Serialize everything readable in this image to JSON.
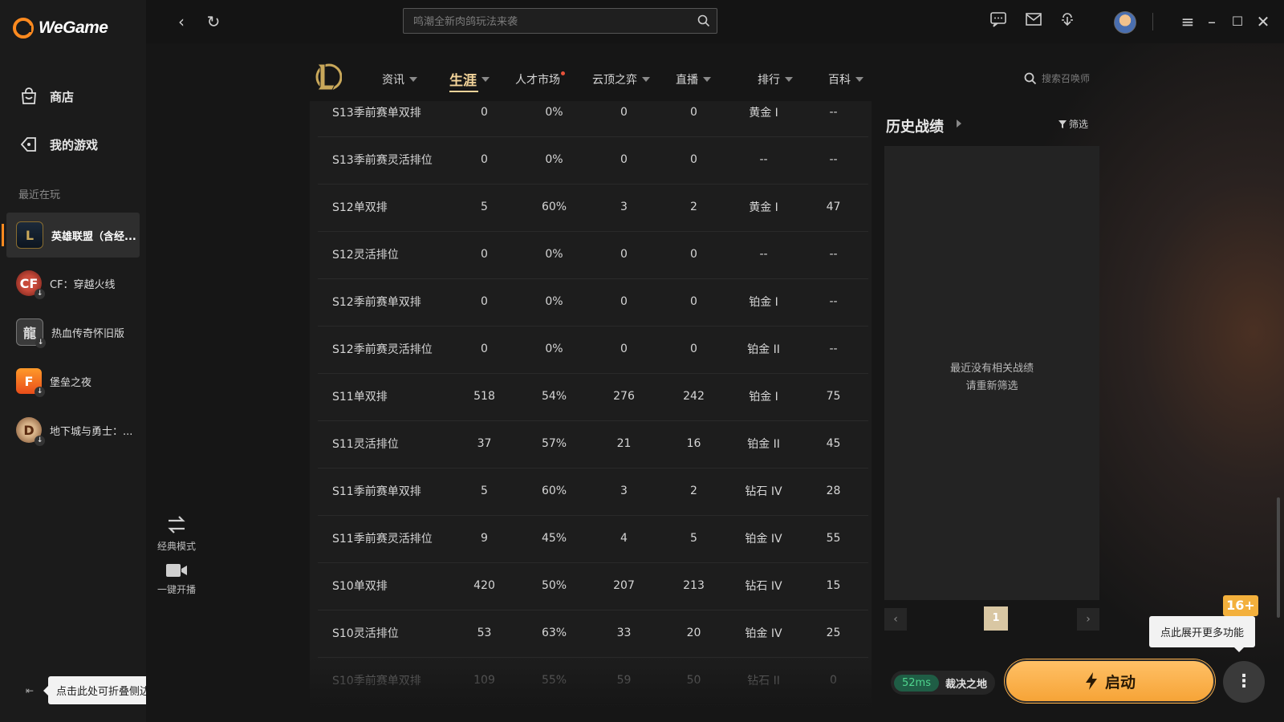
{
  "app": {
    "logo_text": "WeGame"
  },
  "sidebar": {
    "store_label": "商店",
    "mygames_label": "我的游戏",
    "recent_label": "最近在玩",
    "games": [
      {
        "name": "英雄联盟（含经...",
        "icon": "lol-icon",
        "active": true
      },
      {
        "name": "CF：穿越火线",
        "icon": "cf-icon",
        "active": false
      },
      {
        "name": "热血传奇怀旧版",
        "icon": "legend-icon",
        "active": false
      },
      {
        "name": "堡垒之夜",
        "icon": "fortnite-icon",
        "active": false
      },
      {
        "name": "地下城与勇士：...",
        "icon": "dnf-icon",
        "active": false
      }
    ],
    "collapse_tip": "点击此处可折叠侧边栏"
  },
  "topbar": {
    "search_placeholder": "鸣潮全新肉鸽玩法来袭"
  },
  "nav": {
    "items": [
      {
        "label": "资讯",
        "caret": true
      },
      {
        "label": "生涯",
        "caret": true,
        "active": true
      },
      {
        "label": "人才市场",
        "caret": false,
        "dot": true
      },
      {
        "label": "云顶之弈",
        "caret": true
      },
      {
        "label": "直播",
        "caret": true
      },
      {
        "label": "排行",
        "caret": true
      },
      {
        "label": "百科",
        "caret": true
      }
    ],
    "summoner_search_placeholder": "搜索召唤师"
  },
  "table": {
    "rows": [
      [
        "S13季前赛单双排",
        "0",
        "0%",
        "0",
        "0",
        "黄金 I",
        "--"
      ],
      [
        "S13季前赛灵活排位",
        "0",
        "0%",
        "0",
        "0",
        "--",
        "--"
      ],
      [
        "S12单双排",
        "5",
        "60%",
        "3",
        "2",
        "黄金 I",
        "47"
      ],
      [
        "S12灵活排位",
        "0",
        "0%",
        "0",
        "0",
        "--",
        "--"
      ],
      [
        "S12季前赛单双排",
        "0",
        "0%",
        "0",
        "0",
        "铂金 I",
        "--"
      ],
      [
        "S12季前赛灵活排位",
        "0",
        "0%",
        "0",
        "0",
        "铂金 II",
        "--"
      ],
      [
        "S11单双排",
        "518",
        "54%",
        "276",
        "242",
        "铂金 I",
        "75"
      ],
      [
        "S11灵活排位",
        "37",
        "57%",
        "21",
        "16",
        "铂金 II",
        "45"
      ],
      [
        "S11季前赛单双排",
        "5",
        "60%",
        "3",
        "2",
        "钻石 IV",
        "28"
      ],
      [
        "S11季前赛灵活排位",
        "9",
        "45%",
        "4",
        "5",
        "铂金 IV",
        "55"
      ],
      [
        "S10单双排",
        "420",
        "50%",
        "207",
        "213",
        "钻石 IV",
        "15"
      ],
      [
        "S10灵活排位",
        "53",
        "63%",
        "33",
        "20",
        "铂金 IV",
        "25"
      ],
      [
        "S10季前赛单双排",
        "109",
        "55%",
        "59",
        "50",
        "钻石 II",
        "0"
      ]
    ]
  },
  "modes": {
    "classic_label": "经典模式",
    "stream_label": "一键开播"
  },
  "history": {
    "title": "历史战绩",
    "filter_label": "筛选",
    "empty_line1": "最近没有相关战绩",
    "empty_line2": "请重新筛选",
    "current_page": "1"
  },
  "launch": {
    "ping": "52ms",
    "map": "裁决之地",
    "button_label": "启动",
    "more_tip": "点此展开更多功能",
    "age_badge": "16+"
  },
  "colors": {
    "accent": "#ff8a1f",
    "active_nav": "#f3d49a",
    "launch_button": "#f6a437",
    "ping_green": "#4fd48d"
  }
}
